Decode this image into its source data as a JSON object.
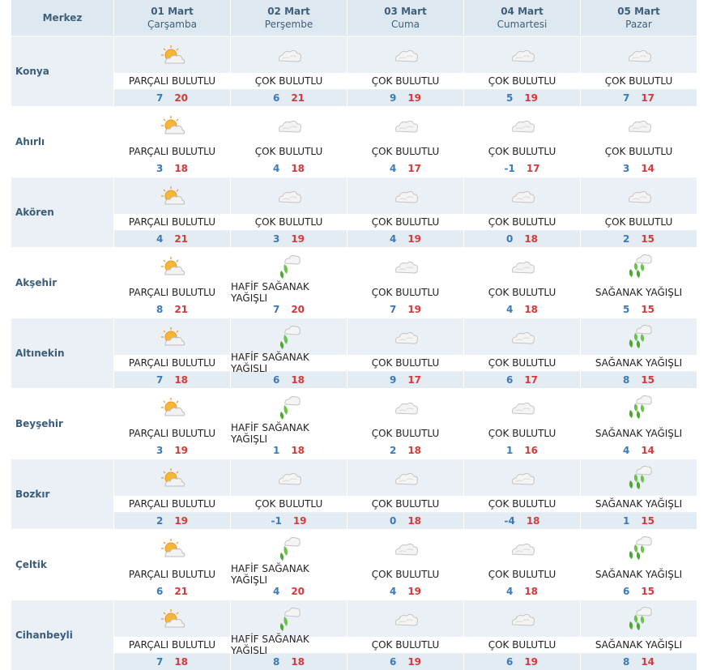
{
  "header": {
    "title": "Merkez",
    "days": [
      {
        "date": "01 Mart",
        "day": "Çarşamba"
      },
      {
        "date": "02 Mart",
        "day": "Perşembe"
      },
      {
        "date": "03 Mart",
        "day": "Cuma"
      },
      {
        "date": "04 Mart",
        "day": "Cumartesi"
      },
      {
        "date": "05 Mart",
        "day": "Pazar"
      }
    ]
  },
  "colors": {
    "header_bg": "#dde8f1",
    "alt_row_bg": "#eaf0f6",
    "min_temp": "#3b7ab8",
    "max_temp": "#d23b3b"
  },
  "rows": [
    {
      "city": "Konya",
      "days": [
        {
          "icon": "partly-cloudy-icon",
          "condition": "PARÇALI BULUTLU",
          "min": "7",
          "max": "20"
        },
        {
          "icon": "cloudy-icon",
          "condition": "ÇOK BULUTLU",
          "min": "6",
          "max": "21"
        },
        {
          "icon": "cloudy-icon",
          "condition": "ÇOK BULUTLU",
          "min": "9",
          "max": "19"
        },
        {
          "icon": "cloudy-icon",
          "condition": "ÇOK BULUTLU",
          "min": "5",
          "max": "19"
        },
        {
          "icon": "cloudy-icon",
          "condition": "ÇOK BULUTLU",
          "min": "7",
          "max": "17"
        }
      ]
    },
    {
      "city": "Ahırlı",
      "days": [
        {
          "icon": "partly-cloudy-icon",
          "condition": "PARÇALI BULUTLU",
          "min": "3",
          "max": "18"
        },
        {
          "icon": "cloudy-icon",
          "condition": "ÇOK BULUTLU",
          "min": "4",
          "max": "18"
        },
        {
          "icon": "cloudy-icon",
          "condition": "ÇOK BULUTLU",
          "min": "4",
          "max": "17"
        },
        {
          "icon": "cloudy-icon",
          "condition": "ÇOK BULUTLU",
          "min": "-1",
          "max": "17"
        },
        {
          "icon": "cloudy-icon",
          "condition": "ÇOK BULUTLU",
          "min": "3",
          "max": "14"
        }
      ]
    },
    {
      "city": "Akören",
      "days": [
        {
          "icon": "partly-cloudy-icon",
          "condition": "PARÇALI BULUTLU",
          "min": "4",
          "max": "21"
        },
        {
          "icon": "cloudy-icon",
          "condition": "ÇOK BULUTLU",
          "min": "3",
          "max": "19"
        },
        {
          "icon": "cloudy-icon",
          "condition": "ÇOK BULUTLU",
          "min": "4",
          "max": "19"
        },
        {
          "icon": "cloudy-icon",
          "condition": "ÇOK BULUTLU",
          "min": "0",
          "max": "18"
        },
        {
          "icon": "cloudy-icon",
          "condition": "ÇOK BULUTLU",
          "min": "2",
          "max": "15"
        }
      ]
    },
    {
      "city": "Akşehir",
      "days": [
        {
          "icon": "partly-cloudy-icon",
          "condition": "PARÇALI BULUTLU",
          "min": "8",
          "max": "21"
        },
        {
          "icon": "light-shower-icon",
          "condition": "HAFİF SAĞANAK YAĞIŞLI",
          "min": "7",
          "max": "20"
        },
        {
          "icon": "cloudy-icon",
          "condition": "ÇOK BULUTLU",
          "min": "7",
          "max": "19"
        },
        {
          "icon": "cloudy-icon",
          "condition": "ÇOK BULUTLU",
          "min": "4",
          "max": "18"
        },
        {
          "icon": "shower-icon",
          "condition": "SAĞANAK YAĞIŞLI",
          "min": "5",
          "max": "15"
        }
      ]
    },
    {
      "city": "Altınekin",
      "days": [
        {
          "icon": "partly-cloudy-icon",
          "condition": "PARÇALI BULUTLU",
          "min": "7",
          "max": "18"
        },
        {
          "icon": "light-shower-icon",
          "condition": "HAFİF SAĞANAK YAĞIŞLI",
          "min": "6",
          "max": "18"
        },
        {
          "icon": "cloudy-icon",
          "condition": "ÇOK BULUTLU",
          "min": "9",
          "max": "17"
        },
        {
          "icon": "cloudy-icon",
          "condition": "ÇOK BULUTLU",
          "min": "6",
          "max": "17"
        },
        {
          "icon": "shower-icon",
          "condition": "SAĞANAK YAĞIŞLI",
          "min": "8",
          "max": "15"
        }
      ]
    },
    {
      "city": "Beyşehir",
      "days": [
        {
          "icon": "partly-cloudy-icon",
          "condition": "PARÇALI BULUTLU",
          "min": "3",
          "max": "19"
        },
        {
          "icon": "light-shower-icon",
          "condition": "HAFİF SAĞANAK YAĞIŞLI",
          "min": "1",
          "max": "18"
        },
        {
          "icon": "cloudy-icon",
          "condition": "ÇOK BULUTLU",
          "min": "2",
          "max": "18"
        },
        {
          "icon": "cloudy-icon",
          "condition": "ÇOK BULUTLU",
          "min": "1",
          "max": "16"
        },
        {
          "icon": "shower-icon",
          "condition": "SAĞANAK YAĞIŞLI",
          "min": "4",
          "max": "14"
        }
      ]
    },
    {
      "city": "Bozkır",
      "days": [
        {
          "icon": "partly-cloudy-icon",
          "condition": "PARÇALI BULUTLU",
          "min": "2",
          "max": "19"
        },
        {
          "icon": "cloudy-icon",
          "condition": "ÇOK BULUTLU",
          "min": "-1",
          "max": "19"
        },
        {
          "icon": "cloudy-icon",
          "condition": "ÇOK BULUTLU",
          "min": "0",
          "max": "18"
        },
        {
          "icon": "cloudy-icon",
          "condition": "ÇOK BULUTLU",
          "min": "-4",
          "max": "18"
        },
        {
          "icon": "shower-icon",
          "condition": "SAĞANAK YAĞIŞLI",
          "min": "1",
          "max": "15"
        }
      ]
    },
    {
      "city": "Çeltik",
      "days": [
        {
          "icon": "partly-cloudy-icon",
          "condition": "PARÇALI BULUTLU",
          "min": "6",
          "max": "21"
        },
        {
          "icon": "light-shower-icon",
          "condition": "HAFİF SAĞANAK YAĞIŞLI",
          "min": "4",
          "max": "20"
        },
        {
          "icon": "cloudy-icon",
          "condition": "ÇOK BULUTLU",
          "min": "4",
          "max": "19"
        },
        {
          "icon": "cloudy-icon",
          "condition": "ÇOK BULUTLU",
          "min": "4",
          "max": "18"
        },
        {
          "icon": "shower-icon",
          "condition": "SAĞANAK YAĞIŞLI",
          "min": "6",
          "max": "15"
        }
      ]
    },
    {
      "city": "Cihanbeyli",
      "days": [
        {
          "icon": "partly-cloudy-icon",
          "condition": "PARÇALI BULUTLU",
          "min": "7",
          "max": "18"
        },
        {
          "icon": "light-shower-icon",
          "condition": "HAFİF SAĞANAK YAĞIŞLI",
          "min": "8",
          "max": "18"
        },
        {
          "icon": "cloudy-icon",
          "condition": "ÇOK BULUTLU",
          "min": "6",
          "max": "19"
        },
        {
          "icon": "cloudy-icon",
          "condition": "ÇOK BULUTLU",
          "min": "6",
          "max": "19"
        },
        {
          "icon": "shower-icon",
          "condition": "SAĞANAK YAĞIŞLI",
          "min": "8",
          "max": "14"
        }
      ]
    }
  ]
}
